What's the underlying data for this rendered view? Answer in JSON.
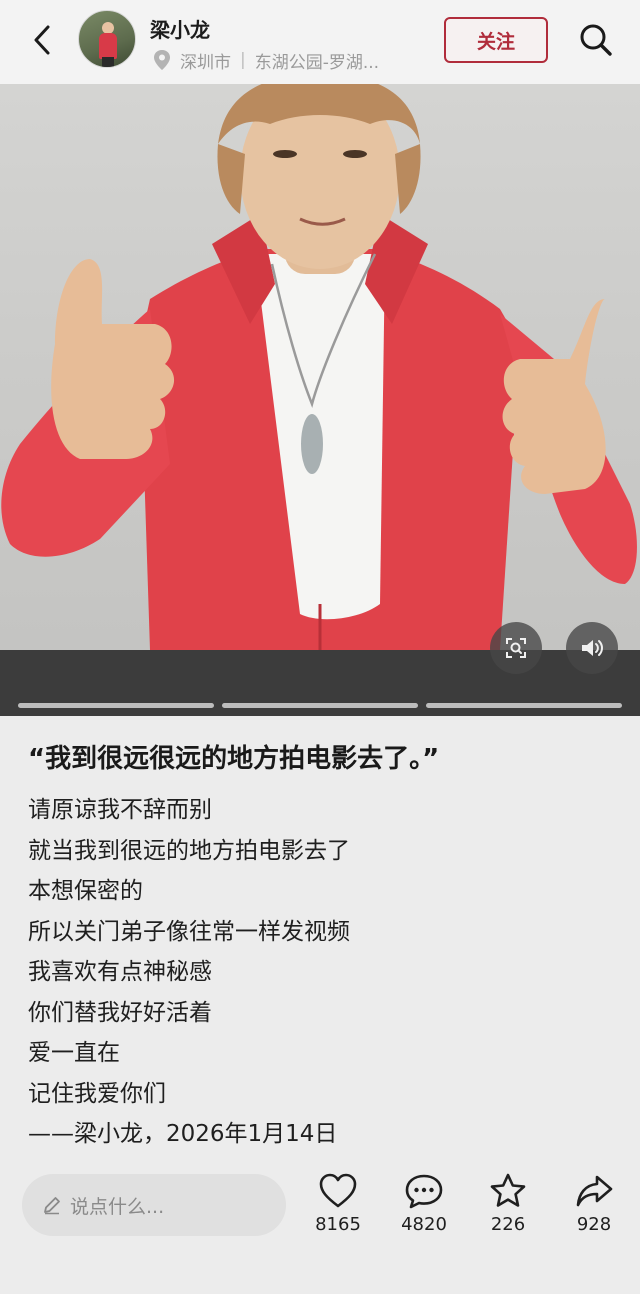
{
  "header": {
    "user_name": "梁小龙",
    "location_city": "深圳市",
    "location_place": "东湖公园-罗湖...",
    "follow_label": "关注"
  },
  "caption": {
    "title": "“我到很远很远的地方拍电影去了。”",
    "lines": [
      "请原谅我不辞而别",
      "就当我到很远的地方拍电影去了",
      "本想保密的",
      "所以关门弟子像往常一样发视频",
      "我喜欢有点神秘感",
      "你们替我好好活着",
      "爱一直在",
      "记住我爱你们",
      "——梁小龙，2026年1月14日"
    ]
  },
  "media": {
    "slide_count": 3
  },
  "bottom_bar": {
    "comment_placeholder": "说点什么...",
    "likes": "8165",
    "comments": "4820",
    "favorites": "226",
    "shares": "928"
  },
  "colors": {
    "accent": "#b02c3b",
    "jacket": "#e0424a",
    "background": "#ececec"
  }
}
